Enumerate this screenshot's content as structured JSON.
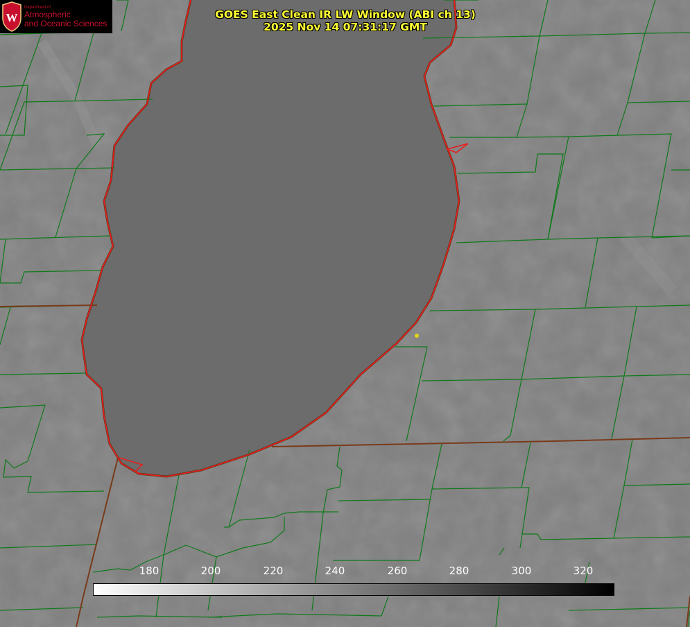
{
  "title": {
    "line1": "GOES East Clean IR LW Window (ABI ch 13)",
    "line2": "2025 Nov 14 07:31:17 GMT"
  },
  "logo": {
    "small_text": "Department of",
    "line1": "Atmospheric",
    "line2": "and Oceanic Sciences",
    "seal_letter": "W"
  },
  "colorbar": {
    "ticks": [
      "180",
      "200",
      "220",
      "240",
      "260",
      "280",
      "300",
      "320"
    ],
    "colors": {
      "low": "#ffffff",
      "high": "#000000"
    }
  },
  "map": {
    "colors": {
      "lake": "#6b6b6b",
      "land": "#7f7f7f",
      "county_line": "#0f7a1a",
      "shoreline": "#ee1b1b",
      "station_marker": "#e3d416"
    },
    "features": [
      "lake-surface",
      "state-borders",
      "county-lines",
      "shoreline",
      "station-marker"
    ]
  }
}
